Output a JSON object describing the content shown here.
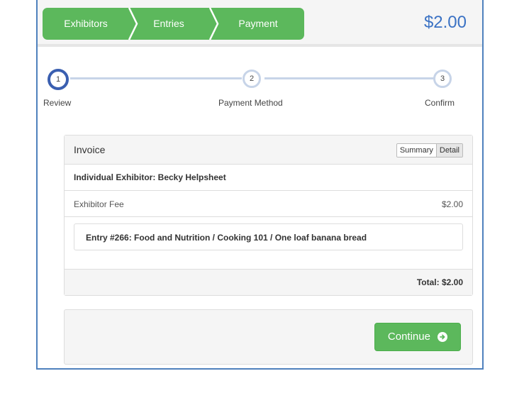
{
  "breadcrumb": {
    "steps": [
      "Exhibitors",
      "Entries",
      "Payment"
    ]
  },
  "header": {
    "total": "$2.00"
  },
  "stepper": {
    "steps": [
      {
        "number": "1",
        "label": "Review"
      },
      {
        "number": "2",
        "label": "Payment Method"
      },
      {
        "number": "3",
        "label": "Confirm"
      }
    ]
  },
  "invoice": {
    "title": "Invoice",
    "view_toggle": [
      "Summary",
      "Detail"
    ],
    "exhibitor": "Individual Exhibitor: Becky Helpsheet",
    "fee_label": "Exhibitor Fee",
    "fee_amount": "$2.00",
    "entry": "Entry #266: Food and Nutrition / Cooking 101 / One loaf banana bread",
    "total": "Total: $2.00"
  },
  "actions": {
    "continue_label": "Continue"
  },
  "colors": {
    "accent_green": "#5cb85c",
    "total_blue": "#3b72c4",
    "active_step": "#3a5fb0",
    "frame_border": "#4f81bd"
  }
}
